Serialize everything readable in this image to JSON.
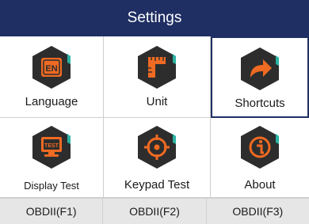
{
  "title": "Settings",
  "tiles": [
    {
      "label": "Language",
      "icon": "language-icon",
      "selected": false
    },
    {
      "label": "Unit",
      "icon": "unit-icon",
      "selected": false
    },
    {
      "label": "Shortcuts",
      "icon": "shortcuts-icon",
      "selected": true
    },
    {
      "label": "Display Test",
      "icon": "display-test-icon",
      "selected": false
    },
    {
      "label": "Keypad Test",
      "icon": "keypad-test-icon",
      "selected": false
    },
    {
      "label": "About",
      "icon": "about-icon",
      "selected": false
    }
  ],
  "icon_text": {
    "language": "EN",
    "display_test": "TEST"
  },
  "function_keys": [
    "OBDII(F1)",
    "OBDII(F2)",
    "OBDII(F3)"
  ],
  "colors": {
    "title_bar": "#1f2f63",
    "icon_dark": "#2d2d2d",
    "icon_accent": "#ef6a22",
    "icon_teal": "#2bb3a3",
    "selection": "#1f2f63"
  }
}
